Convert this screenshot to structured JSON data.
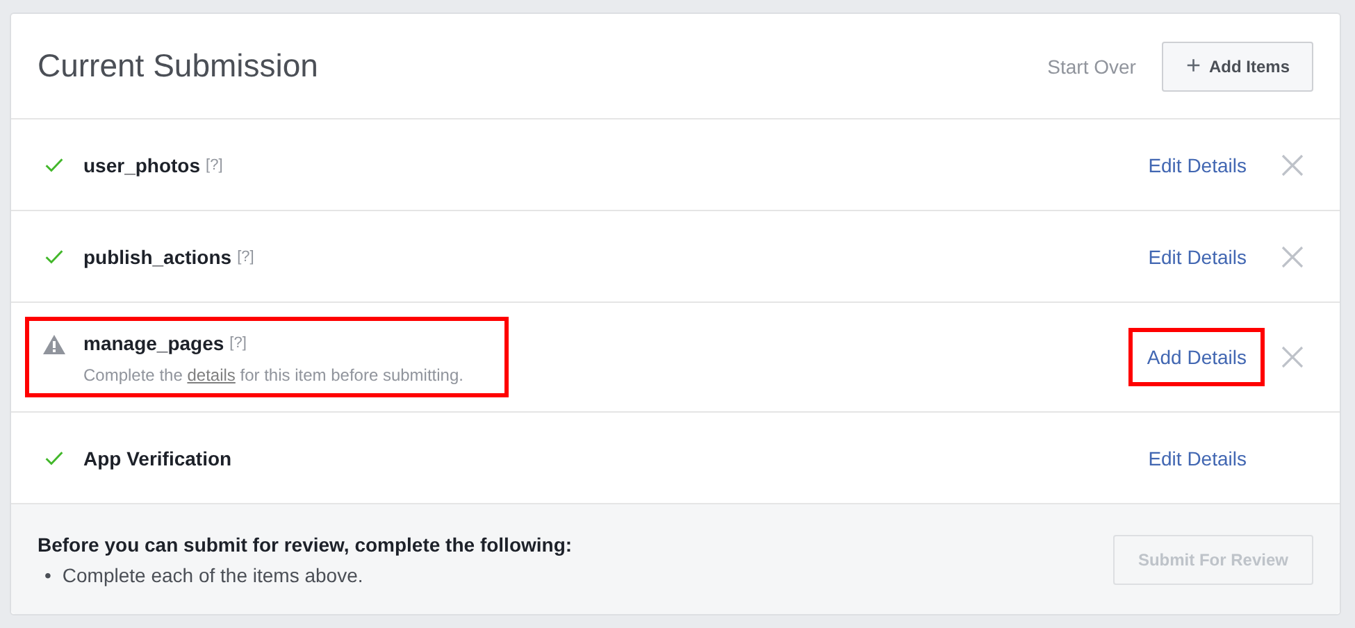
{
  "header": {
    "title": "Current Submission",
    "start_over": "Start Over",
    "add_button": {
      "icon": "+",
      "label": "Add Items"
    }
  },
  "items": [
    {
      "name": "user_photos",
      "help": "[?]",
      "complete": true,
      "action": "Edit Details",
      "removable": true,
      "highlighted": false,
      "action_highlighted": false
    },
    {
      "name": "publish_actions",
      "help": "[?]",
      "complete": true,
      "action": "Edit Details",
      "removable": true,
      "highlighted": false,
      "action_highlighted": false
    },
    {
      "name": "manage_pages",
      "help": "[?]",
      "complete": false,
      "message": {
        "before": "Complete the",
        "link": "details",
        "after": "for this item before submitting."
      },
      "action": "Add Details",
      "removable": true,
      "highlighted": true,
      "action_highlighted": true
    },
    {
      "name": "App Verification",
      "complete": true,
      "action": "Edit Details",
      "removable": false,
      "highlighted": false,
      "action_highlighted": false
    }
  ],
  "footer": {
    "heading": "Before you can submit for review, complete the following:",
    "requirements": [
      {
        "bullet": "•",
        "text": "Complete each of the items above."
      }
    ],
    "submit_button": {
      "label": "Submit For Review",
      "disabled": true
    }
  }
}
